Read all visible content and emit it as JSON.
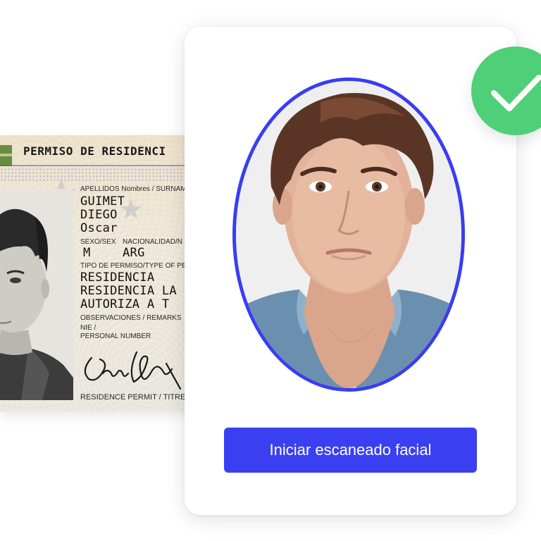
{
  "id_card": {
    "header_title": "PERMISO DE RESIDENCI",
    "surnames_label": "APELLIDOS Nombres / SURNAM",
    "surname_1": "GUIMET",
    "surname_2": "DIEGO",
    "given_name": "Oscar",
    "sex_label": "SEXO/SEX",
    "nationality_label": "NACIONALIDAD/N",
    "sex_value": "M",
    "nationality_value": "ARG",
    "permit_type_label": "TIPO DE PERMISO/TYPE OF PER",
    "permit_line_1": "RESIDENCIA",
    "permit_line_2": "RESIDENCIA LA",
    "permit_line_3": "AUTORIZA A T",
    "remarks_label": "OBSERVACIONES / REMARKS",
    "nie_label": "NIE /",
    "personal_number_label": "PERSONAL NUMBER",
    "footer_text": "RESIDENCE PERMIT / TITRE"
  },
  "verification": {
    "scan_button_label": "Iniciar escaneado facial",
    "status_icon": "check-icon"
  },
  "colors": {
    "accent": "#3a40f2",
    "oval_border": "#3a3df0",
    "success": "#4fcf78"
  }
}
